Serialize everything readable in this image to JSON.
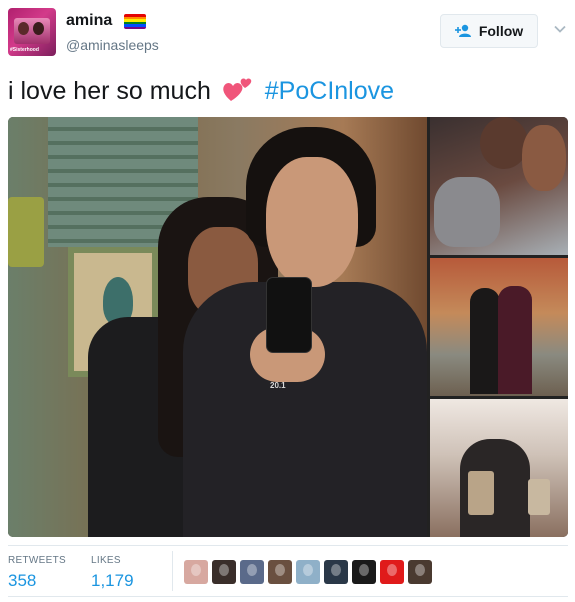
{
  "author": {
    "name": "amina",
    "handle": "@aminasleeps",
    "avatar_icon": "profile-avatar",
    "avatar_text": "#Sisterhood",
    "flag_icon": "rainbow-flag-icon",
    "flag_colors": [
      "#e40303",
      "#ff8c00",
      "#ffed00",
      "#008026",
      "#004dff",
      "#750787"
    ]
  },
  "actions": {
    "follow_label": "Follow",
    "follow_icon": "add-user-icon",
    "menu_icon": "chevron-down-icon"
  },
  "tweet": {
    "text": "i love her so much",
    "emoji_icon": "two-hearts-icon",
    "hashtag": "#PoCInlove"
  },
  "media": {
    "main_photo": "selfie-photo",
    "shirt_text": "20.1",
    "side_photos": [
      "cat-photo",
      "couple-photo",
      "mirror-selfie-photo"
    ]
  },
  "stats": {
    "retweets_label": "RETWEETS",
    "retweets_value": "358",
    "likes_label": "LIKES",
    "likes_value": "1,179"
  },
  "likers": [
    {
      "icon": "liker-avatar-1",
      "color": "#d7a8a0"
    },
    {
      "icon": "liker-avatar-2",
      "color": "#3a2e2a"
    },
    {
      "icon": "liker-avatar-3",
      "color": "#5a6a8a"
    },
    {
      "icon": "liker-avatar-4",
      "color": "#6a5040"
    },
    {
      "icon": "liker-avatar-5",
      "color": "#8fb0c8"
    },
    {
      "icon": "liker-avatar-6",
      "color": "#2a3848"
    },
    {
      "icon": "liker-avatar-7",
      "color": "#1a1a1a"
    },
    {
      "icon": "liker-avatar-8",
      "color": "#e01a1a"
    },
    {
      "icon": "liker-avatar-9",
      "color": "#4a3a30"
    }
  ],
  "colors": {
    "accent": "#1b95e0",
    "muted": "#657786",
    "border": "#e1e8ed"
  }
}
